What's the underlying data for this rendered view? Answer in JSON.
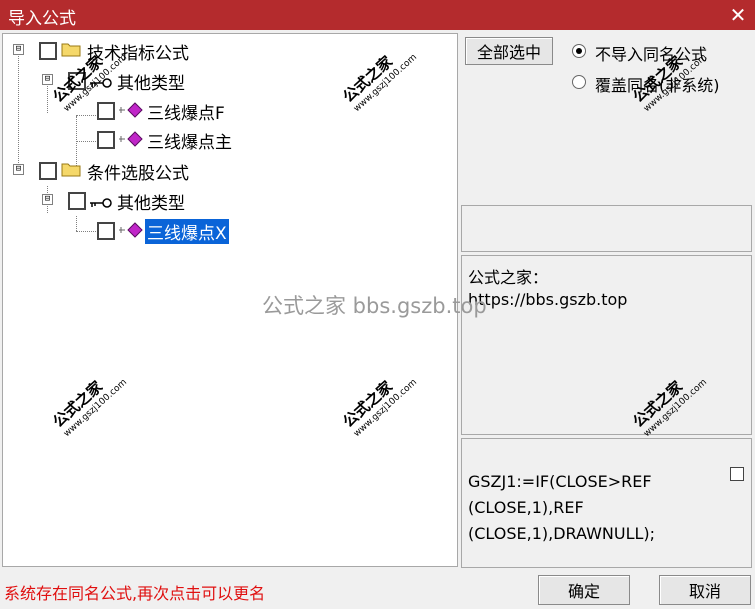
{
  "window": {
    "title": "导入公式",
    "close_glyph": "✕"
  },
  "tree": {
    "nodes": [
      {
        "label": "技术指标公式",
        "expander": "⊟",
        "icon": "folder-icon",
        "checked": false
      },
      {
        "label": "其他类型",
        "expander": "⊟",
        "icon": "key-icon",
        "checked": false
      },
      {
        "label": "三线爆点F",
        "icon": "formula-gem-icon",
        "checked": false
      },
      {
        "label": "三线爆点主",
        "icon": "formula-gem-icon",
        "checked": false
      },
      {
        "label": "条件选股公式",
        "expander": "⊟",
        "icon": "folder-icon",
        "checked": false
      },
      {
        "label": "其他类型",
        "expander": "⊟",
        "icon": "key-icon",
        "checked": false
      },
      {
        "label": "三线爆点X",
        "icon": "formula-gem-icon",
        "checked": false,
        "selected": true
      }
    ]
  },
  "options": {
    "select_all_label": "全部选中",
    "radio_no_import": "不导入同名公式",
    "radio_overwrite": "覆盖同名(非系统)",
    "selected_radio": "no_import"
  },
  "info_text": {
    "line1": "公式之家：",
    "line2": "https://bbs.gszb.top"
  },
  "code_text": {
    "line1": "GSZJ1:=IF(CLOSE>REF",
    "line2": "(CLOSE,1),REF",
    "line3": "(CLOSE,1),DRAWNULL);"
  },
  "watermark": {
    "cn": "公式之家",
    "url": "www.gszj100.com",
    "center": "公式之家 bbs.gszb.top"
  },
  "status_text": "系统存在同名公式,再次点击可以更名",
  "buttons": {
    "ok": "确定",
    "cancel": "取消"
  },
  "colors": {
    "titlebar": "#b42b2d",
    "selection": "#0a64d8",
    "status": "#e01010"
  }
}
